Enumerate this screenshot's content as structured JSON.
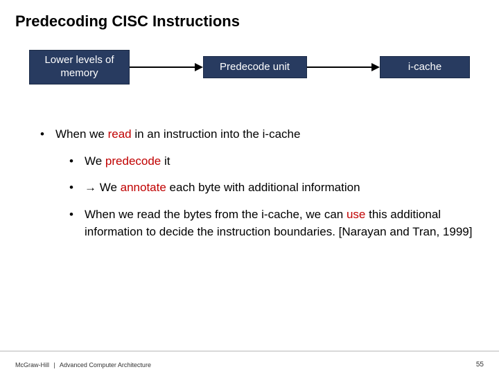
{
  "title": "Predecoding CISC Instructions",
  "diagram": {
    "box1": "Lower levels of memory",
    "box2": "Predecode unit",
    "box3": "i-cache"
  },
  "bullets": {
    "main_pre": "When we ",
    "main_red": "read",
    "main_post": " in an instruction into the i-cache",
    "sub1_pre": "We ",
    "sub1_red": "predecode",
    "sub1_post": " it",
    "sub2_arrow": "→",
    "sub2_pre": " We ",
    "sub2_red": "annotate",
    "sub2_post": " each byte with additional information",
    "sub3_a": "When we read the bytes from the i-cache, we can ",
    "sub3_red": "use",
    "sub3_b": " this additional information to decide the instruction boundaries. [Narayan and Tran, 1999]"
  },
  "footer": {
    "left1": "McGraw-Hill",
    "sep": "|",
    "left2": "Advanced Computer Architecture",
    "page": "55"
  }
}
